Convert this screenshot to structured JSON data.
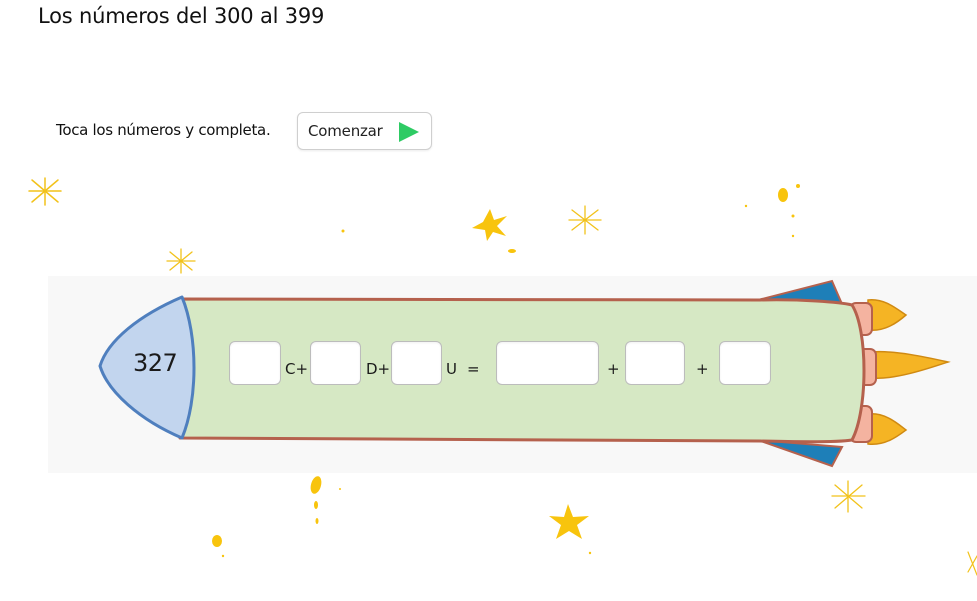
{
  "page": {
    "title": "Los números del 300 al 399",
    "instruction": "Toca los números y completa.",
    "start_button_label": "Comenzar"
  },
  "exercise": {
    "number": "327",
    "labels": {
      "hundreds_op": "C+",
      "tens_op": "D+",
      "units_op": "U",
      "equals": "=",
      "plus1": "+",
      "plus2": "+"
    },
    "inputs": {
      "hundreds": "",
      "tens": "",
      "units": "",
      "sum_hundreds": "",
      "sum_tens": "",
      "sum_units": ""
    }
  },
  "colors": {
    "rocket_body": "#d6e8c4",
    "rocket_outline": "#b5614d",
    "nose_fill": "#c2d5ee",
    "nose_outline": "#4f7fbe",
    "fin": "#1e7fb8",
    "flame": "#f5b424",
    "play_icon": "#2ecb64",
    "star": "#f8c40d"
  },
  "icons": {
    "play": "play-icon",
    "star": "star-icon",
    "sparkle": "sparkle-icon"
  }
}
